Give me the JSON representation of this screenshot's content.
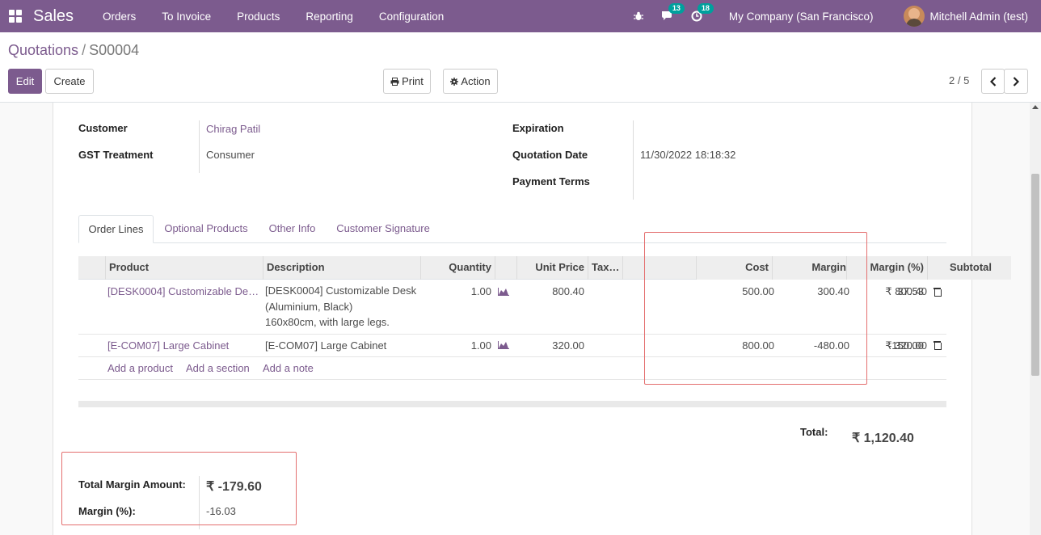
{
  "navbar": {
    "app_name": "Sales",
    "menu": [
      "Orders",
      "To Invoice",
      "Products",
      "Reporting",
      "Configuration"
    ],
    "chat_count": "13",
    "activity_count": "18",
    "company": "My Company (San Francisco)",
    "user": "Mitchell Admin (test)",
    "brand_color": "#7c5b8e"
  },
  "control": {
    "breadcrumb_parent": "Quotations",
    "breadcrumb_sep": "/",
    "breadcrumb_current": "S00004",
    "edit_label": "Edit",
    "create_label": "Create",
    "print_label": "Print",
    "action_label": "Action",
    "pager": "2 / 5"
  },
  "form": {
    "customer_label": "Customer",
    "customer_value": "Chirag Patil",
    "gst_label": "GST Treatment",
    "gst_value": "Consumer",
    "expiration_label": "Expiration",
    "quotation_date_label": "Quotation Date",
    "quotation_date_value": "11/30/2022 18:18:32",
    "payment_terms_label": "Payment Terms"
  },
  "tabs": [
    "Order Lines",
    "Optional Products",
    "Other Info",
    "Customer Signature"
  ],
  "table": {
    "headers": {
      "product": "Product",
      "description": "Description",
      "quantity": "Quantity",
      "unit_price": "Unit Price",
      "taxes": "Tax…",
      "cost": "Cost",
      "margin": "Margin",
      "margin_pct": "Margin (%)",
      "subtotal": "Subtotal"
    },
    "rows": [
      {
        "product": "[DESK0004] Customizable De…",
        "description": [
          "[DESK0004] Customizable Desk",
          "(Aluminium, Black)",
          "160x80cm, with large legs."
        ],
        "quantity": "1.00",
        "unit_price": "800.40",
        "cost": "500.00",
        "margin": "300.40",
        "margin_pct": "37.53",
        "subtotal": "₹ 800.40"
      },
      {
        "product": "[E-COM07] Large Cabinet",
        "description": [
          "[E-COM07] Large Cabinet"
        ],
        "quantity": "1.00",
        "unit_price": "320.00",
        "cost": "800.00",
        "margin": "-480.00",
        "margin_pct": "-150.00",
        "subtotal": "₹ 320.00"
      }
    ],
    "add_product": "Add a product",
    "add_section": "Add a section",
    "add_note": "Add a note"
  },
  "totals": {
    "total_label": "Total:",
    "total_value": "₹ 1,120.40",
    "total_margin_label": "Total Margin Amount:",
    "total_margin_value": "₹ -179.60",
    "margin_pct_label": "Margin (%):",
    "margin_pct_value": "-16.03"
  },
  "colors": {
    "highlight": "#e46f6f",
    "badge": "#00a09d"
  }
}
